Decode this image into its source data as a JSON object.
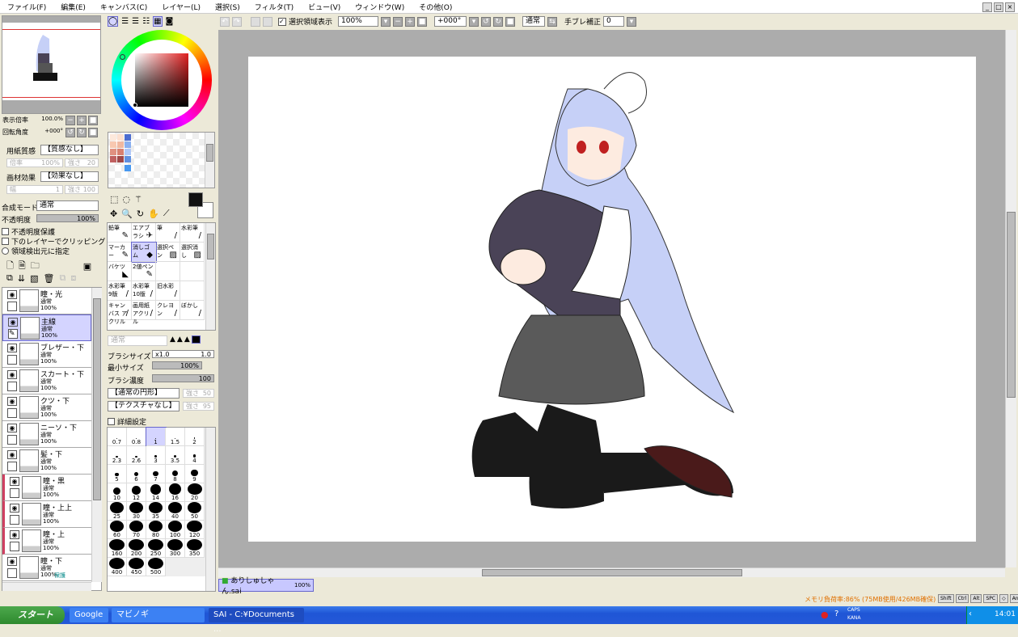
{
  "menu": [
    "ファイル(F)",
    "編集(E)",
    "キャンバス(C)",
    "レイヤー(L)",
    "選択(S)",
    "フィルタ(T)",
    "ビュー(V)",
    "ウィンドウ(W)",
    "その他(O)"
  ],
  "navigator": {
    "zoom_label": "表示倍率",
    "zoom_value": "100.0%",
    "rotate_label": "回転角度",
    "rotate_value": "+000°"
  },
  "paper": {
    "texture_label": "用紙質感",
    "texture_value": "【質感なし】",
    "scale_label": "倍率",
    "scale_value": "100%",
    "strength_label": "強さ",
    "strength_value": "20",
    "effect_label": "画材効果",
    "effect_value": "【効果なし】",
    "width_label": "幅",
    "width_value": "1",
    "strength2_label": "強さ",
    "strength2_value": "100"
  },
  "layer_props": {
    "blend_label": "合成モード",
    "blend_value": "通常",
    "opacity_label": "不透明度",
    "opacity_value": "100%",
    "opacity_fraction": 1.0,
    "preserve_opacity": "不透明度保護",
    "clipping": "下のレイヤーでクリッピング",
    "selection_source": "領域検出元に指定"
  },
  "layers": [
    {
      "name": "瞳・光",
      "mode": "通常",
      "opacity": "100%"
    },
    {
      "name": "主線",
      "mode": "通常",
      "opacity": "100%",
      "active": true
    },
    {
      "name": "ブレザー・下",
      "mode": "通常",
      "opacity": "100%"
    },
    {
      "name": "スカート・下",
      "mode": "通常",
      "opacity": "100%"
    },
    {
      "name": "クツ・下",
      "mode": "通常",
      "opacity": "100%"
    },
    {
      "name": "ニーソ・下",
      "mode": "通常",
      "opacity": "100%"
    },
    {
      "name": "髪・下",
      "mode": "通常",
      "opacity": "100%"
    },
    {
      "name": "瞳・黒",
      "mode": "通常",
      "opacity": "100%",
      "clip": true
    },
    {
      "name": "瞳・上上",
      "mode": "通常",
      "opacity": "100%",
      "clip": true
    },
    {
      "name": "瞳・上",
      "mode": "通常",
      "opacity": "100%",
      "clip": true
    },
    {
      "name": "瞳・下",
      "mode": "通常",
      "opacity": "100%",
      "extra": "保護"
    }
  ],
  "tools": [
    {
      "label": "鉛筆",
      "icon": "✎"
    },
    {
      "label": "エアブラシ",
      "icon": "✈"
    },
    {
      "label": "筆",
      "icon": "/"
    },
    {
      "label": "水彩筆",
      "icon": "/"
    },
    {
      "label": "マーカー",
      "icon": "✎"
    },
    {
      "label": "消しゴム",
      "icon": "◆",
      "active": true
    },
    {
      "label": "選択ペン",
      "icon": "▨"
    },
    {
      "label": "選択消し",
      "icon": "▨"
    },
    {
      "label": "バケツ",
      "icon": "◣"
    },
    {
      "label": "2値ペン",
      "icon": "✎"
    },
    {
      "label": "",
      "icon": ""
    },
    {
      "label": "",
      "icon": ""
    },
    {
      "label": "水彩筆 9版",
      "icon": "/"
    },
    {
      "label": "水彩筆 10版",
      "icon": "/"
    },
    {
      "label": "旧水彩",
      "icon": "/"
    },
    {
      "label": "",
      "icon": ""
    },
    {
      "label": "キャンバス アクリル",
      "icon": "/"
    },
    {
      "label": "画用紙 アクリル",
      "icon": "/"
    },
    {
      "label": "クレヨン",
      "icon": "/"
    },
    {
      "label": "ぼかし",
      "icon": "/"
    }
  ],
  "brush": {
    "mode": "通常",
    "size_label": "ブラシサイズ",
    "size_mult": "x1.0",
    "size_value": "1.0",
    "min_label": "最小サイズ",
    "min_value": "100%",
    "density_label": "ブラシ濃度",
    "density_value": "100",
    "shape": "【通常の円形】",
    "shape_strength_label": "強さ",
    "shape_strength": "50",
    "texture": "【テクスチャなし】",
    "texture_strength_label": "強さ",
    "texture_strength": "95",
    "advanced": "詳細設定"
  },
  "brush_sizes": [
    "0.7",
    "0.8",
    "1",
    "1.5",
    "2",
    "2.3",
    "2.6",
    "3",
    "3.5",
    "4",
    "5",
    "6",
    "7",
    "8",
    "9",
    "10",
    "12",
    "14",
    "16",
    "20",
    "25",
    "30",
    "35",
    "40",
    "50",
    "60",
    "70",
    "80",
    "100",
    "120",
    "160",
    "200",
    "250",
    "300",
    "350",
    "400",
    "450",
    "500"
  ],
  "active_brush_size": "1",
  "toolbar": {
    "show_selection": "選択領域表示",
    "zoom": "100%",
    "rotation": "+000°",
    "mode": "通常",
    "stabilizer_label": "手ブレ補正",
    "stabilizer": "0"
  },
  "document_tab": {
    "name": "ありしゅしゃん.sai",
    "zoom": "100%"
  },
  "status": {
    "memory": "メモリ負荷率:86% (75MB使用/426MB確保)",
    "keys": [
      "Shift",
      "Ctrl",
      "Alt",
      "SPC",
      "◇",
      "Any",
      "✎"
    ]
  },
  "taskbar": {
    "start": "スタート",
    "items": [
      "Google",
      "マビノギ",
      "SAI - C:¥Documents ..."
    ],
    "ime_top": "CAPS",
    "ime_bottom": "KANA",
    "clock": "14:01"
  },
  "colors": {
    "hair": "#c6d0f7",
    "vest": "#4a4357",
    "skirt": "#5a5a5a",
    "stocking": "#1a1a1a",
    "skin": "#fdebe0",
    "shoe": "#4a1a1a",
    "accent": "#d4d4ff"
  }
}
